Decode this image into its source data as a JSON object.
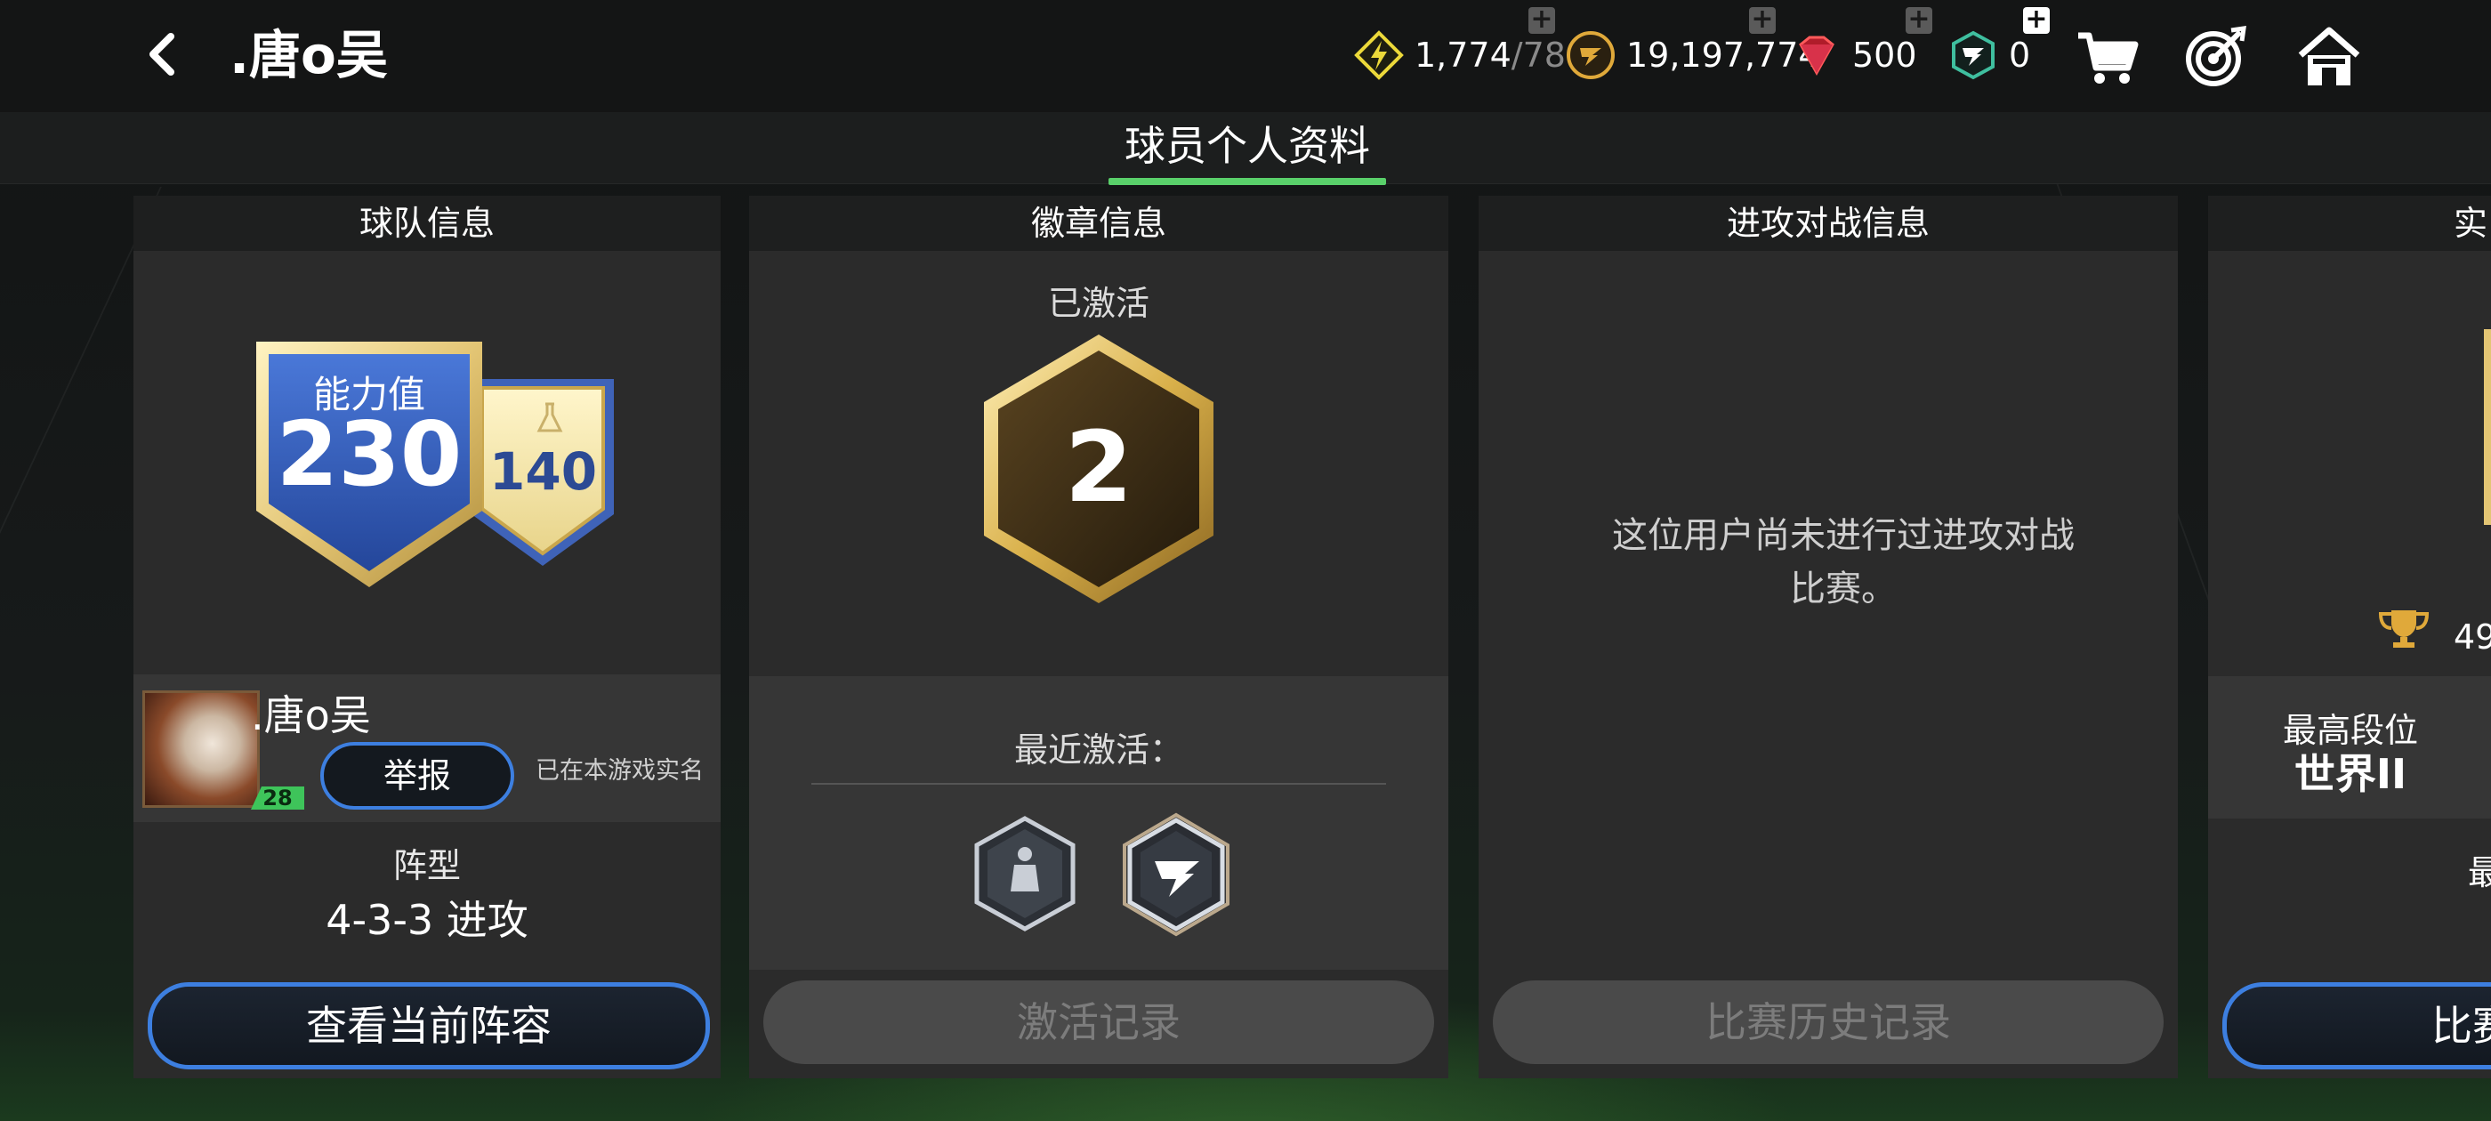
{
  "header": {
    "title": ".唐o吴",
    "currencies": [
      {
        "icon": "energy-icon",
        "value": "1,774",
        "suffix": "/78"
      },
      {
        "icon": "coin-icon",
        "value": "19,197,774"
      },
      {
        "icon": "gem-icon",
        "value": "500"
      },
      {
        "icon": "fc-points-icon",
        "value": "0"
      }
    ],
    "plus_symbol": "+"
  },
  "tab": {
    "label": "球员个人资料"
  },
  "team_panel": {
    "title": "球队信息",
    "ovr_label": "能力值",
    "ovr_value": "230",
    "lab_value": "140",
    "player_name": ".唐o吴",
    "level": "28",
    "report_button": "举报",
    "verified_text": "已在本游戏实名",
    "formation_label": "阵型",
    "formation_value": "4-3-3 进攻",
    "view_button": "查看当前阵容"
  },
  "badge_panel": {
    "title": "徽章信息",
    "activated_label": "已激活",
    "activated_count": "2",
    "recent_label": "最近激活：",
    "recent_badges": [
      "trophy-figure-badge-icon",
      "fc-logo-badge-icon"
    ],
    "history_button": "激活记录"
  },
  "attack_panel": {
    "title": "进攻对战信息",
    "empty_text_line1": "这位用户尚未进行过进攻对战",
    "empty_text_line2": "比赛。",
    "history_button": "比赛历史记录"
  },
  "rank_panel": {
    "title_partial": "实",
    "trophy_value_partial": "49",
    "highest_rank_label": "最高段位",
    "highest_rank_value": "世界II",
    "label_partial": "最",
    "button_partial": "比赛"
  },
  "colors": {
    "accent_blue": "#3d7fe0",
    "tab_green": "#59d06a",
    "gold": "#e9c868",
    "energy_yellow": "#ecd93a"
  }
}
